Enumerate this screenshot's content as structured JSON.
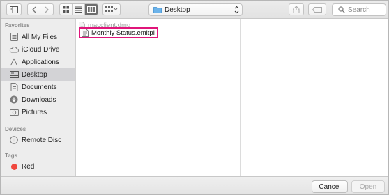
{
  "toolbar": {
    "location": "Desktop",
    "search_placeholder": "Search"
  },
  "sidebar": {
    "favorites_header": "Favorites",
    "favorites": [
      {
        "label": "All My Files",
        "icon": "all-files-icon"
      },
      {
        "label": "iCloud Drive",
        "icon": "cloud-icon"
      },
      {
        "label": "Applications",
        "icon": "applications-icon"
      },
      {
        "label": "Desktop",
        "icon": "desktop-icon",
        "selected": true
      },
      {
        "label": "Documents",
        "icon": "documents-icon"
      },
      {
        "label": "Downloads",
        "icon": "downloads-icon"
      },
      {
        "label": "Pictures",
        "icon": "pictures-icon"
      }
    ],
    "devices_header": "Devices",
    "devices": [
      {
        "label": "Remote Disc",
        "icon": "disc-icon"
      }
    ],
    "tags_header": "Tags",
    "tags": [
      {
        "label": "Red",
        "color": "#f0483e"
      }
    ]
  },
  "files": [
    {
      "name": "macclient.dmg",
      "dimmed": true,
      "icon": "dmg-file-icon"
    },
    {
      "name": "Monthly Status.emltpl",
      "highlighted": true,
      "icon": "template-file-icon"
    }
  ],
  "footer": {
    "cancel_label": "Cancel",
    "open_label": "Open"
  },
  "colors": {
    "highlight_border": "#e0157a",
    "selected_row": "#d3d3d6",
    "tag_red": "#f0483e"
  }
}
